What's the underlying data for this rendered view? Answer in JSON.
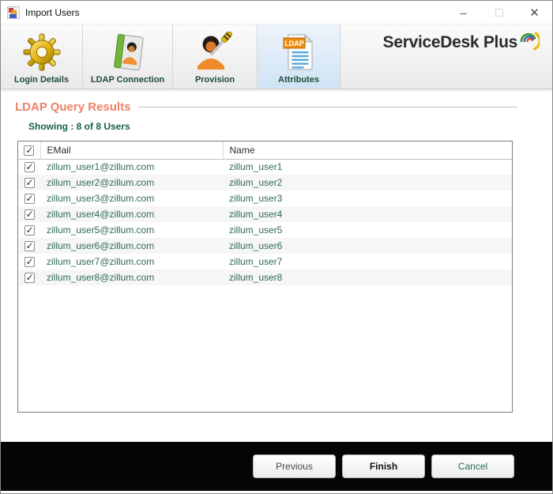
{
  "window": {
    "title": "Import Users"
  },
  "titlebar": {
    "minimize_glyph": "–",
    "close_glyph": "✕"
  },
  "brand": {
    "name": "ServiceDesk Plus"
  },
  "wizard": {
    "ldap_badge": "LDAP",
    "steps": [
      {
        "label": "Login Details",
        "icon": "gear-icon",
        "selected": false
      },
      {
        "label": "LDAP Connection",
        "icon": "address-book-icon",
        "selected": false
      },
      {
        "label": "Provision",
        "icon": "user-screwdriver-icon",
        "selected": false
      },
      {
        "label": "Attributes",
        "icon": "ldap-document-icon",
        "selected": true
      }
    ]
  },
  "main": {
    "heading": "LDAP Query Results",
    "showing": "Showing : 8 of 8 Users"
  },
  "table": {
    "headers": {
      "email": "EMail",
      "name": "Name"
    },
    "header_checkbox_checked": true,
    "rows": [
      {
        "email": "zillum_user1@zillum.com",
        "name": "zillum_user1",
        "checked": true
      },
      {
        "email": "zillum_user2@zillum.com",
        "name": "zillum_user2",
        "checked": true
      },
      {
        "email": "zillum_user3@zillum.com",
        "name": "zillum_user3",
        "checked": true
      },
      {
        "email": "zillum_user4@zillum.com",
        "name": "zillum_user4",
        "checked": true
      },
      {
        "email": "zillum_user5@zillum.com",
        "name": "zillum_user5",
        "checked": true
      },
      {
        "email": "zillum_user6@zillum.com",
        "name": "zillum_user6",
        "checked": true
      },
      {
        "email": "zillum_user7@zillum.com",
        "name": "zillum_user7",
        "checked": true
      },
      {
        "email": "zillum_user8@zillum.com",
        "name": "zillum_user8",
        "checked": true
      }
    ]
  },
  "footer": {
    "previous_label": "Previous",
    "finish_label": "Finish",
    "cancel_label": "Cancel"
  },
  "colors": {
    "heading_accent": "#ee8167",
    "table_text_green": "#2f6a52",
    "step_label_green": "#1d4d33",
    "selected_step_blue": "#cfe3f5",
    "footer_bg": "#050505"
  }
}
